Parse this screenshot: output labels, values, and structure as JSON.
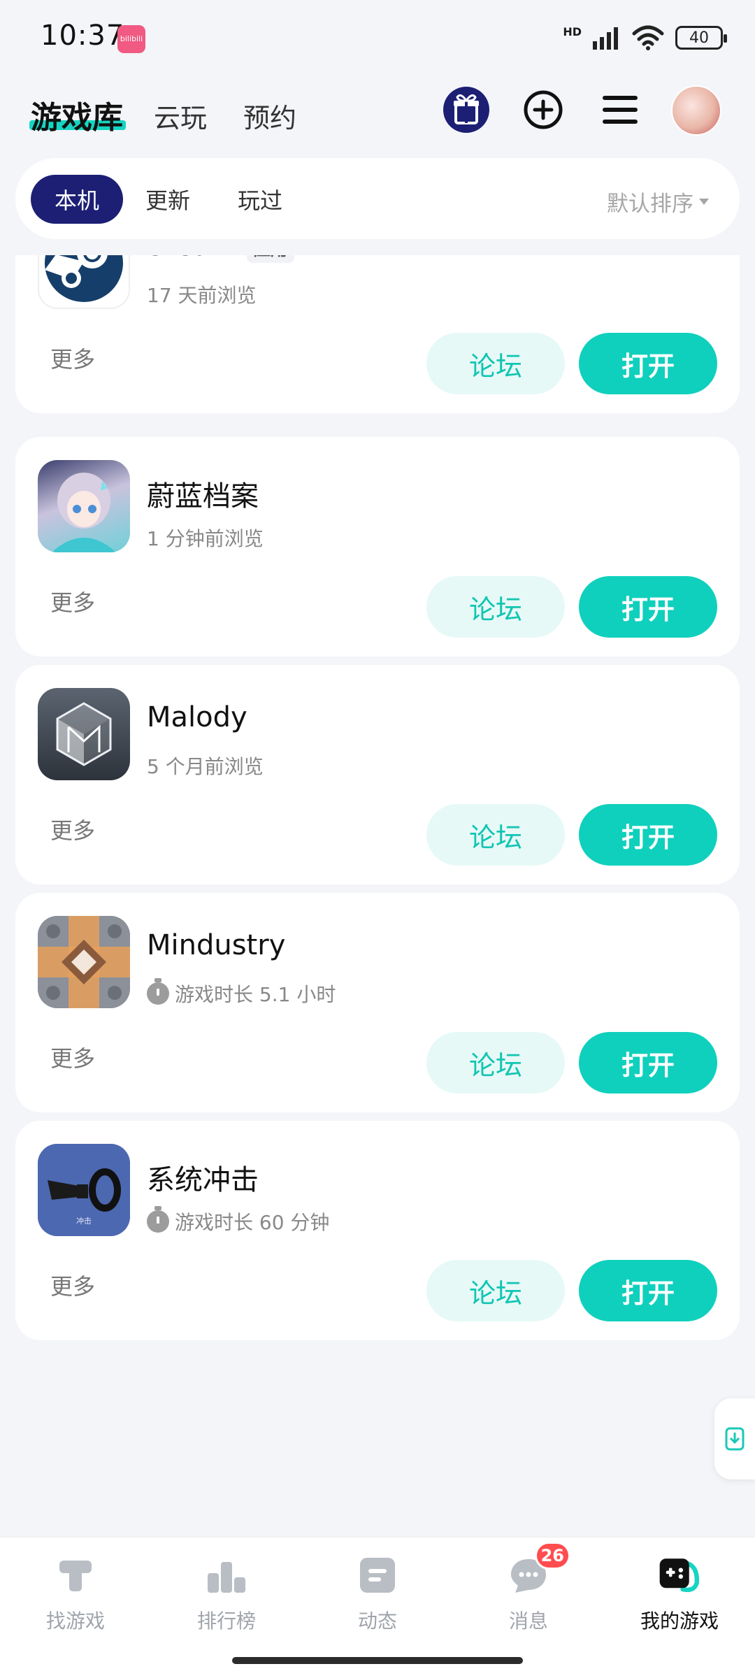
{
  "status_bar": {
    "time": "10:37",
    "app_icon_text": "bilibili",
    "network": "HD",
    "battery": "40"
  },
  "header": {
    "tabs": [
      {
        "label": "游戏库",
        "active": true
      },
      {
        "label": "云玩",
        "active": false
      },
      {
        "label": "预约",
        "active": false
      }
    ],
    "icons": [
      "gift-icon",
      "add-circle-icon",
      "menu-icon"
    ]
  },
  "filters": {
    "chips": [
      {
        "label": "本机",
        "active": true
      },
      {
        "label": "更新",
        "active": false
      },
      {
        "label": "玩过",
        "active": false
      }
    ],
    "sort_label": "默认排序"
  },
  "games": [
    {
      "title": "Steam",
      "tag": "应用",
      "subtitle": "17 天前浏览",
      "more": "更多",
      "forum": "论坛",
      "open": "打开",
      "icon": "steam-icon"
    },
    {
      "title": "蔚蓝档案",
      "subtitle": "1 分钟前浏览",
      "more": "更多",
      "forum": "论坛",
      "open": "打开",
      "icon": "blue-archive-icon"
    },
    {
      "title": "Malody",
      "subtitle": "5 个月前浏览",
      "more": "更多",
      "forum": "论坛",
      "open": "打开",
      "icon": "malody-icon"
    },
    {
      "title": "Mindustry",
      "subtitle": "游戏时长 5.1 小时",
      "more": "更多",
      "forum": "论坛",
      "open": "打开",
      "icon": "mindustry-icon"
    },
    {
      "title": "系统冲击",
      "subtitle": "游戏时长 60 分钟",
      "more": "更多",
      "forum": "论坛",
      "open": "打开",
      "icon": "system-shock-icon",
      "icon_text": "冲击"
    }
  ],
  "bottom_nav": [
    {
      "label": "找游戏",
      "icon": "find-game-icon"
    },
    {
      "label": "排行榜",
      "icon": "ranking-icon"
    },
    {
      "label": "动态",
      "icon": "feed-icon"
    },
    {
      "label": "消息",
      "icon": "message-icon",
      "badge": "26"
    },
    {
      "label": "我的游戏",
      "icon": "my-games-icon",
      "active": true
    }
  ],
  "colors": {
    "accent": "#0fd0bc",
    "accent_light": "#e6f9f7",
    "chip_active": "#1c1f74",
    "background": "#f4f5f9",
    "badge": "#ff4d4f"
  }
}
